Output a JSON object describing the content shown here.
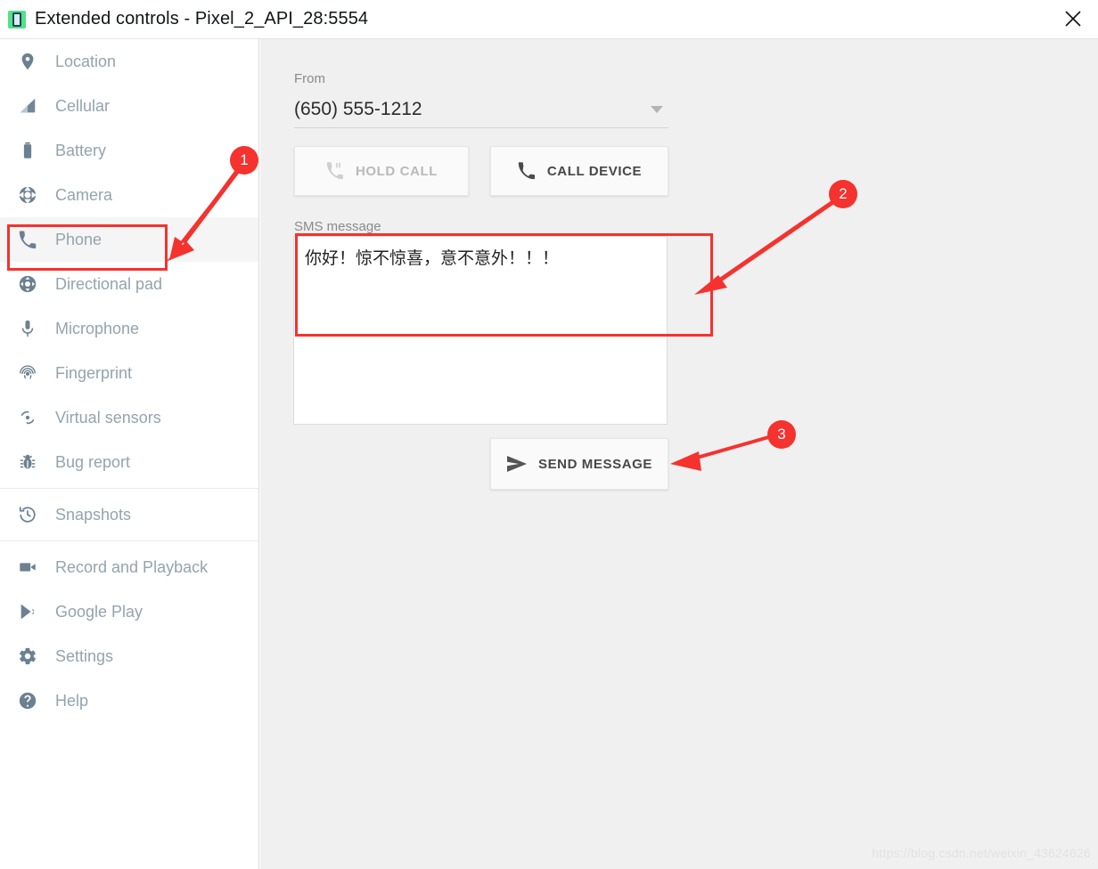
{
  "window": {
    "title": "Extended controls - Pixel_2_API_28:5554",
    "app_icon": "android-emulator-icon",
    "close_label": "close-icon"
  },
  "sidebar": {
    "items": [
      {
        "label": "Location",
        "icon": "location-pin-icon",
        "selected": false,
        "divider_after": false
      },
      {
        "label": "Cellular",
        "icon": "cellular-signal-icon",
        "selected": false,
        "divider_after": false
      },
      {
        "label": "Battery",
        "icon": "battery-icon",
        "selected": false,
        "divider_after": false
      },
      {
        "label": "Camera",
        "icon": "camera-aperture-icon",
        "selected": false,
        "divider_after": false
      },
      {
        "label": "Phone",
        "icon": "phone-handset-icon",
        "selected": true,
        "divider_after": false
      },
      {
        "label": "Directional pad",
        "icon": "directional-pad-icon",
        "selected": false,
        "divider_after": false
      },
      {
        "label": "Microphone",
        "icon": "microphone-icon",
        "selected": false,
        "divider_after": false
      },
      {
        "label": "Fingerprint",
        "icon": "fingerprint-icon",
        "selected": false,
        "divider_after": false
      },
      {
        "label": "Virtual sensors",
        "icon": "virtual-sensors-icon",
        "selected": false,
        "divider_after": false
      },
      {
        "label": "Bug report",
        "icon": "bug-icon",
        "selected": false,
        "divider_after": true
      },
      {
        "label": "Snapshots",
        "icon": "history-clock-icon",
        "selected": false,
        "divider_after": true
      },
      {
        "label": "Record and Playback",
        "icon": "video-camera-icon",
        "selected": false,
        "divider_after": false
      },
      {
        "label": "Google Play",
        "icon": "google-play-icon",
        "selected": false,
        "divider_after": false
      },
      {
        "label": "Settings",
        "icon": "gear-icon",
        "selected": false,
        "divider_after": false
      },
      {
        "label": "Help",
        "icon": "help-circle-icon",
        "selected": false,
        "divider_after": false
      }
    ]
  },
  "main": {
    "from": {
      "label": "From",
      "value": "(650) 555-1212",
      "caret_icon": "chevron-down-icon"
    },
    "hold_call": {
      "label": "HOLD CALL",
      "icon": "phone-pause-icon",
      "disabled": true
    },
    "call_device": {
      "label": "CALL DEVICE",
      "icon": "phone-handset-icon",
      "disabled": false
    },
    "sms": {
      "label": "SMS message",
      "value": "你好！惊不惊喜，意不意外！！！",
      "placeholder": ""
    },
    "send_message": {
      "label": "SEND MESSAGE",
      "icon": "send-paper-plane-icon"
    },
    "watermark": "https://blog.csdn.net/weixin_43624626"
  },
  "annotations": {
    "accent_color": "#f5322e",
    "markers": [
      {
        "number": "1",
        "target": "sidebar-item-phone"
      },
      {
        "number": "2",
        "target": "sms-textarea"
      },
      {
        "number": "3",
        "target": "send-message-button"
      }
    ]
  }
}
